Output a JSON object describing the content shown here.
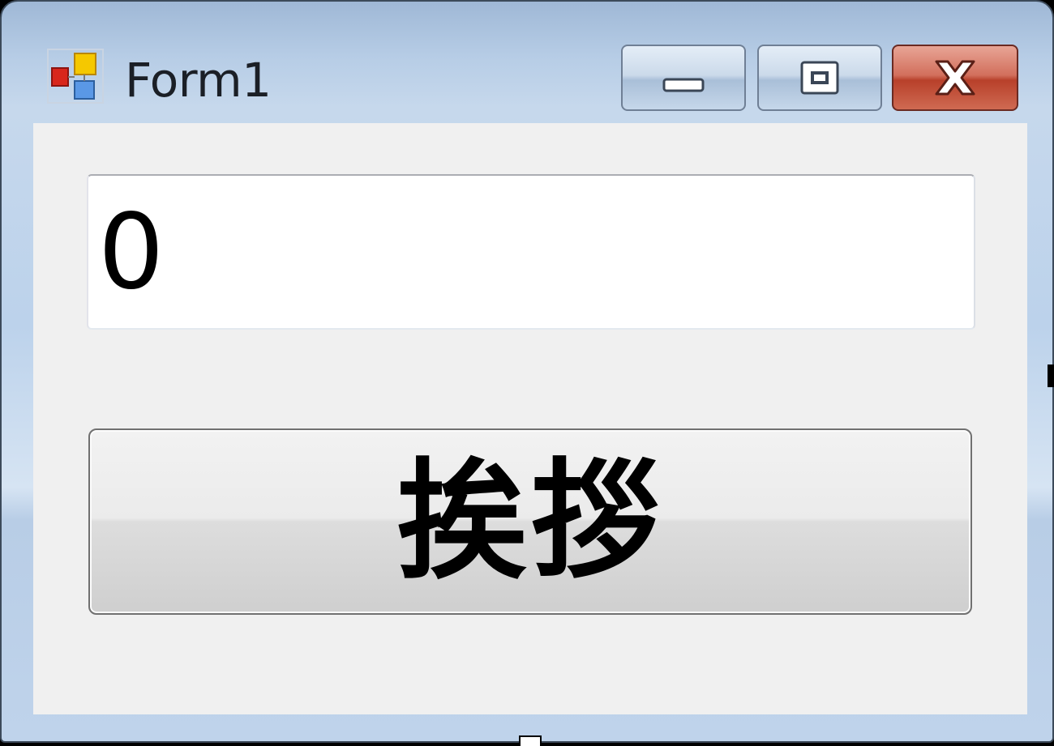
{
  "window": {
    "title": "Form1",
    "icon": "winforms-app-icon",
    "controls": {
      "minimize_icon": "minimize-icon",
      "maximize_icon": "maximize-icon",
      "close_icon": "close-icon"
    }
  },
  "form": {
    "textbox_value": "0",
    "button_label": "挨拶"
  },
  "colors": {
    "frame": "#bcd2eb",
    "client": "#f0f0f0",
    "close_button": "#c8503a"
  }
}
